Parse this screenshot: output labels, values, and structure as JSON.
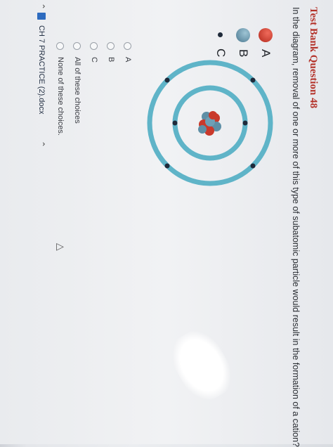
{
  "question": {
    "title": "Test Bank Question 48",
    "text": "In the diagram, removal of one or more of this type of subatomic particle would result in the formation of a cation?"
  },
  "legend": [
    {
      "letter": "A",
      "color": "#c9392b"
    },
    {
      "letter": "B",
      "color": "#5e8fa6"
    },
    {
      "letter": "C",
      "color": "#1f2a3a"
    }
  ],
  "choices": [
    {
      "label": "A"
    },
    {
      "label": "B"
    },
    {
      "label": "C"
    },
    {
      "label": "All of these choices"
    },
    {
      "label": "None of these choices."
    }
  ],
  "taskbar": {
    "document_name": "CH 7 PRACTICE (2).docx"
  },
  "icons": {
    "cursor": "cursor-arrow-icon",
    "document": "word-document-icon"
  },
  "colors": {
    "title": "#b4322a",
    "orbit": "#5fb4c8",
    "proton": "#c9392b",
    "neutron": "#5e8fa6",
    "electron": "#1f2a3a"
  }
}
